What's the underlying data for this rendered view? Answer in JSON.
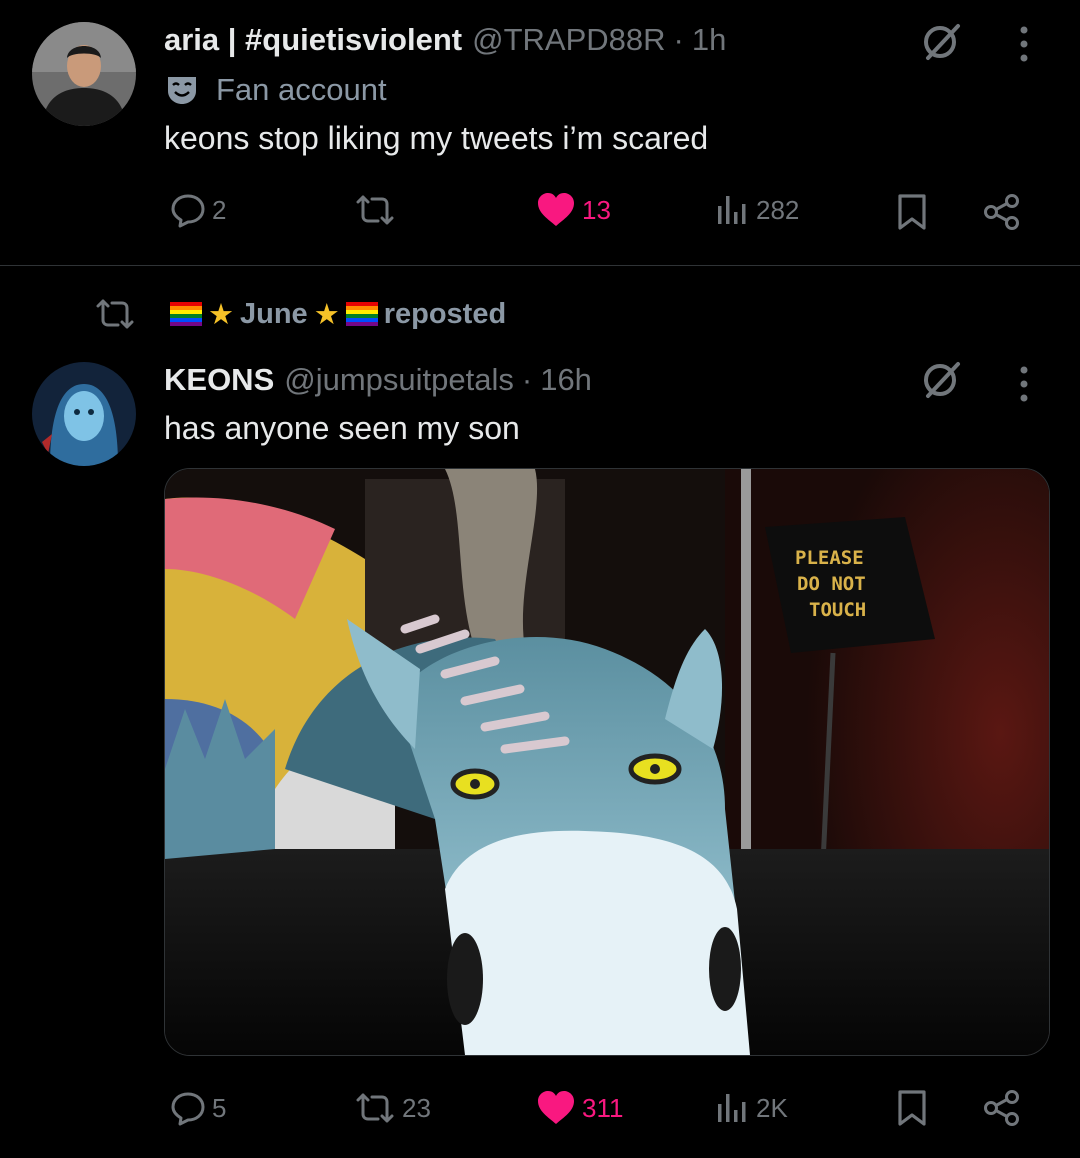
{
  "colors": {
    "background": "#000000",
    "text": "#e7e9ea",
    "muted": "#71767b",
    "like": "#f91880",
    "divider": "#2f3336"
  },
  "tweet1": {
    "display_name": "aria | #quietisviolent",
    "handle": "@TRAPD88R",
    "separator": "·",
    "time": "1h",
    "label_icon": "theater-masks-icon",
    "label": "Fan account",
    "text": "keons stop liking my tweets i’m scared",
    "stats": {
      "replies": "2",
      "reposts": "",
      "likes": "13",
      "views": "282"
    }
  },
  "repost_banner": {
    "left_flag": "🏳️‍🌈",
    "left_star": "★",
    "name": "June",
    "right_star": "★",
    "right_flag": "🏳️‍🌈",
    "suffix": "reposted"
  },
  "tweet2": {
    "display_name": "KEONS",
    "handle": "@jumpsuitpetals",
    "separator": "·",
    "time": "16h",
    "text": "has anyone seen my son",
    "sign_lines": [
      "PLEASE",
      "DO NOT",
      "TOUCH"
    ],
    "stats": {
      "replies": "5",
      "reposts": "23",
      "likes": "311",
      "views": "2K"
    }
  }
}
